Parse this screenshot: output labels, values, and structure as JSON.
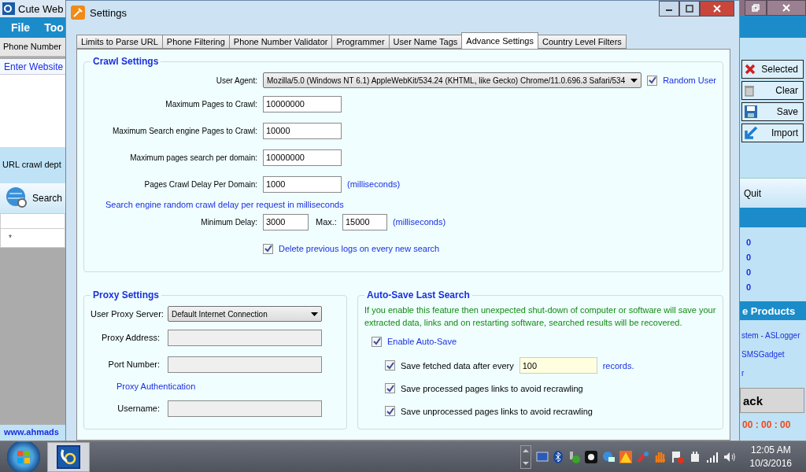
{
  "app": {
    "title": "Cute Web",
    "menu": [
      "File",
      "Too"
    ],
    "toolbar_label": "Phone Number",
    "website_label": "Enter Website",
    "depth_label": "URL crawl dept",
    "search_button": "Search",
    "grid_row_marker": "*",
    "footer_link": "www.ahmads",
    "side_buttons": [
      {
        "kind": "delete",
        "label": "Selected"
      },
      {
        "kind": "clear",
        "label": "Clear"
      },
      {
        "kind": "save",
        "label": "Save"
      },
      {
        "kind": "import",
        "label": "Import"
      }
    ],
    "quit_button": "Quit",
    "counts": [
      "0",
      "0",
      "0",
      "0"
    ],
    "products_title": "e Products",
    "product_links": [
      "stem - ASLogger",
      "SMSGadget",
      "r"
    ],
    "back_button": "ack",
    "timer": "00 : 00 : 00"
  },
  "settings": {
    "title": "Settings",
    "tabs": [
      {
        "label": "Limits to Parse URL",
        "selected": false
      },
      {
        "label": "Phone Filtering",
        "selected": false
      },
      {
        "label": "Phone Number Validator",
        "selected": false
      },
      {
        "label": "Programmer",
        "selected": false
      },
      {
        "label": "User Name Tags",
        "selected": false
      },
      {
        "label": "Advance Settings",
        "selected": true
      },
      {
        "label": "Country Level Filters",
        "selected": false
      }
    ],
    "crawl": {
      "title": "Crawl Settings",
      "user_agent": {
        "label": "User Agent:",
        "value": "Mozilla/5.0 (Windows NT 6.1) AppleWebKit/534.24 (KHTML, like Gecko) Chrome/11.0.696.3 Safari/534",
        "random_checked": true,
        "random_label": "Random User"
      },
      "fields": [
        {
          "label": "Maximum Pages to Crawl:",
          "value": "10000000"
        },
        {
          "label": "Maximum Search engine Pages to Crawl:",
          "value": "10000"
        },
        {
          "label": "Maximum pages search per domain:",
          "value": "10000000"
        },
        {
          "label": "Pages Crawl Delay Per Domain:",
          "value": "1000",
          "unit": "(milliseconds)"
        }
      ],
      "random_delay_note": "Search engine random crawl delay per request in milliseconds",
      "min_delay": {
        "label": "Minimum Delay:",
        "value": "3000"
      },
      "max_delay": {
        "label": "Max.:",
        "value": "15000",
        "unit": "(milliseconds)"
      },
      "delete_logs": {
        "label": "Delete previous logs on every new search",
        "checked": true
      }
    },
    "proxy": {
      "title": "Proxy Settings",
      "server_label": "User Proxy Server:",
      "server_value": "Default Internet Connection",
      "fields": [
        {
          "label": "Proxy Address:"
        },
        {
          "label": "Port Number:"
        }
      ],
      "auth_title": "Proxy Authentication",
      "auth_fields": [
        {
          "label": "Username:"
        }
      ]
    },
    "autosave": {
      "title": "Auto-Save Last Search",
      "note": "If you enable this feature then unexpected shut-down of computer or software will save your extracted data, links and on restarting software, searched results will be recovered.",
      "enable": {
        "label": "Enable Auto-Save",
        "checked": true
      },
      "options": [
        {
          "kind": "with_input",
          "label": "Save fetched data after every",
          "checked": true,
          "value": "100",
          "unit": "records."
        },
        {
          "kind": "plain",
          "label": "Save processed pages links to avoid recrawling",
          "checked": true
        },
        {
          "kind": "plain",
          "label": "Save unprocessed pages links to avoid recrawling",
          "checked": true
        }
      ]
    }
  },
  "taskbar": {
    "time": "12:05 AM",
    "date": "10/3/2016"
  }
}
